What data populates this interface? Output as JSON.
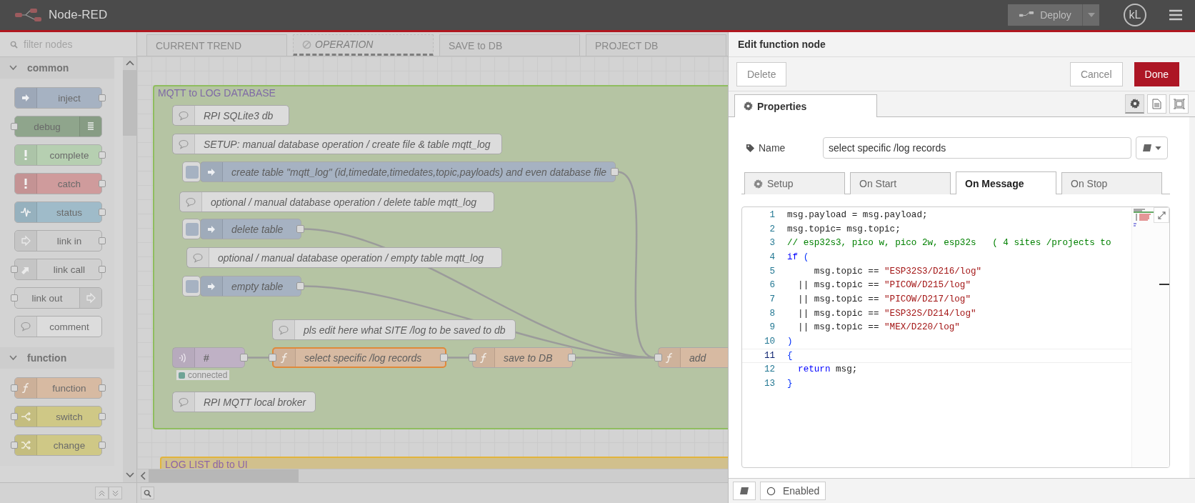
{
  "header": {
    "title": "Node-RED",
    "deploy": {
      "label": "Deploy",
      "disabled": true
    },
    "user": "kL"
  },
  "palette": {
    "filter": {
      "placeholder": "filter nodes"
    },
    "categories": [
      {
        "name": "common",
        "expanded": true,
        "nodes": [
          {
            "label": "inject",
            "kind": "inject",
            "color": "#a6b2c2",
            "input": false,
            "output": true
          },
          {
            "label": "debug",
            "kind": "debug",
            "color": "#8fa58c",
            "input": true,
            "output": false
          },
          {
            "label": "complete",
            "kind": "complete",
            "color": "#b6cfb1",
            "input": false,
            "output": true
          },
          {
            "label": "catch",
            "kind": "catch",
            "color": "#cf9b9c",
            "input": false,
            "output": true
          },
          {
            "label": "status",
            "kind": "status",
            "color": "#9fbbc9",
            "input": false,
            "output": true
          },
          {
            "label": "link in",
            "kind": "linkin",
            "color": "#d0d0d0",
            "input": false,
            "output": true
          },
          {
            "label": "link call",
            "kind": "linkcall",
            "color": "#d0d0d0",
            "input": true,
            "output": true
          },
          {
            "label": "link out",
            "kind": "linkout",
            "color": "#d0d0d0",
            "input": true,
            "output": false
          },
          {
            "label": "comment",
            "kind": "comment",
            "color": "#dcdcdc",
            "input": false,
            "output": false
          }
        ]
      },
      {
        "name": "function",
        "expanded": true,
        "nodes": [
          {
            "label": "function",
            "kind": "function",
            "color": "#d7baa2",
            "input": true,
            "output": true
          },
          {
            "label": "switch",
            "kind": "switch",
            "color": "#cfc886",
            "input": true,
            "output": true
          },
          {
            "label": "change",
            "kind": "change",
            "color": "#cfc886",
            "input": true,
            "output": true
          }
        ]
      }
    ]
  },
  "canvas": {
    "tabs": [
      {
        "label": "CURRENT TREND",
        "disabled": false
      },
      {
        "label": "OPERATION",
        "disabled": true
      },
      {
        "label": "SAVE to DB",
        "disabled": false
      },
      {
        "label": "PROJECT DB",
        "disabled": false
      }
    ],
    "groups": [
      {
        "label": "MQTT to LOG DATABASE",
        "color": "#b5c4a3"
      },
      {
        "label": "LOG LIST db to UI",
        "color": "#d1c08d"
      }
    ],
    "nodes": [
      {
        "kind": "comment",
        "label": "RPI SQLite3 db",
        "selected": false
      },
      {
        "kind": "comment",
        "label": "SETUP: manual database operation / create file & table mqtt_log",
        "selected": false
      },
      {
        "kind": "inject",
        "label": "create table \"mqtt_log\" (id,timedate,timedates,topic,payloads) and even database file",
        "selected": false
      },
      {
        "kind": "comment",
        "label": "optional / manual database operation / delete table mqtt_log",
        "selected": false
      },
      {
        "kind": "inject",
        "label": "delete table",
        "selected": false
      },
      {
        "kind": "comment",
        "label": "optional / manual database operation / empty table mqtt_log",
        "selected": false
      },
      {
        "kind": "inject",
        "label": "empty table",
        "selected": false
      },
      {
        "kind": "comment",
        "label": "pls edit here what SITE /log to be saved to db",
        "selected": false
      },
      {
        "kind": "mqtt",
        "label": "#",
        "selected": false,
        "status": {
          "text": "connected",
          "color": "#6fa396"
        }
      },
      {
        "kind": "function",
        "label": "select specific /log records",
        "selected": true
      },
      {
        "kind": "function",
        "label": "save to DB",
        "selected": false
      },
      {
        "kind": "function",
        "label": "add",
        "selected": false
      },
      {
        "kind": "comment",
        "label": "RPI MQTT local broker",
        "selected": false
      }
    ]
  },
  "editor": {
    "title": "Edit function node",
    "buttons": [
      {
        "label": "Delete",
        "kind": "plain"
      },
      {
        "label": "Cancel",
        "kind": "plain"
      },
      {
        "label": "Done",
        "kind": "primary"
      }
    ],
    "tabs": [
      {
        "label": "Properties",
        "selected": true
      }
    ],
    "tools": [
      {
        "kind": "settings",
        "selected": true
      },
      {
        "kind": "description",
        "selected": false
      },
      {
        "kind": "appearance",
        "selected": false
      }
    ],
    "name": {
      "label": "Name",
      "value": "select specific /log records"
    },
    "code_tabs": [
      {
        "label": "Setup",
        "kind": "settings",
        "selected": false
      },
      {
        "label": "On Start",
        "kind": "plain",
        "selected": false
      },
      {
        "label": "On Message",
        "kind": "plain",
        "selected": true
      },
      {
        "label": "On Stop",
        "kind": "plain",
        "selected": false
      }
    ],
    "code": [
      {
        "number": "1",
        "active": false,
        "tokens": [
          {
            "kind": "plain",
            "text": "msg.payload = msg.payload;"
          }
        ]
      },
      {
        "number": "2",
        "active": false,
        "tokens": [
          {
            "kind": "plain",
            "text": "msg.topic= msg.topic;"
          }
        ]
      },
      {
        "number": "3",
        "active": false,
        "tokens": [
          {
            "kind": "comment",
            "text": "// esp32s3, pico w, pico 2w, esp32s   ( 4 sites /projects to"
          }
        ]
      },
      {
        "number": "4",
        "active": false,
        "tokens": [
          {
            "kind": "keyword",
            "text": "if"
          },
          {
            "kind": "bracket",
            "text": " ("
          }
        ]
      },
      {
        "number": "5",
        "active": false,
        "tokens": [
          {
            "kind": "plain",
            "text": "     msg.topic == "
          },
          {
            "kind": "string",
            "text": "\"ESP32S3/D216/log\""
          }
        ]
      },
      {
        "number": "6",
        "active": false,
        "tokens": [
          {
            "kind": "plain",
            "text": "  || msg.topic == "
          },
          {
            "kind": "string",
            "text": "\"PICOW/D215/log\""
          }
        ]
      },
      {
        "number": "7",
        "active": false,
        "tokens": [
          {
            "kind": "plain",
            "text": "  || msg.topic == "
          },
          {
            "kind": "string",
            "text": "\"PICOW/D217/log\""
          }
        ]
      },
      {
        "number": "8",
        "active": false,
        "tokens": [
          {
            "kind": "plain",
            "text": "  || msg.topic == "
          },
          {
            "kind": "string",
            "text": "\"ESP32S/D214/log\""
          }
        ]
      },
      {
        "number": "9",
        "active": false,
        "tokens": [
          {
            "kind": "plain",
            "text": "  || msg.topic == "
          },
          {
            "kind": "string",
            "text": "\"MEX/D220/log\""
          }
        ]
      },
      {
        "number": "10",
        "active": false,
        "tokens": [
          {
            "kind": "bracket",
            "text": ")"
          }
        ]
      },
      {
        "number": "11",
        "active": true,
        "tokens": [
          {
            "kind": "bracket",
            "text": "{"
          }
        ]
      },
      {
        "number": "12",
        "active": false,
        "tokens": [
          {
            "kind": "keyword",
            "text": "  return"
          },
          {
            "kind": "plain",
            "text": " msg;"
          }
        ]
      },
      {
        "number": "13",
        "active": false,
        "tokens": [
          {
            "kind": "bracket",
            "text": "}"
          }
        ]
      }
    ],
    "footer": {
      "label": "Enabled"
    }
  }
}
